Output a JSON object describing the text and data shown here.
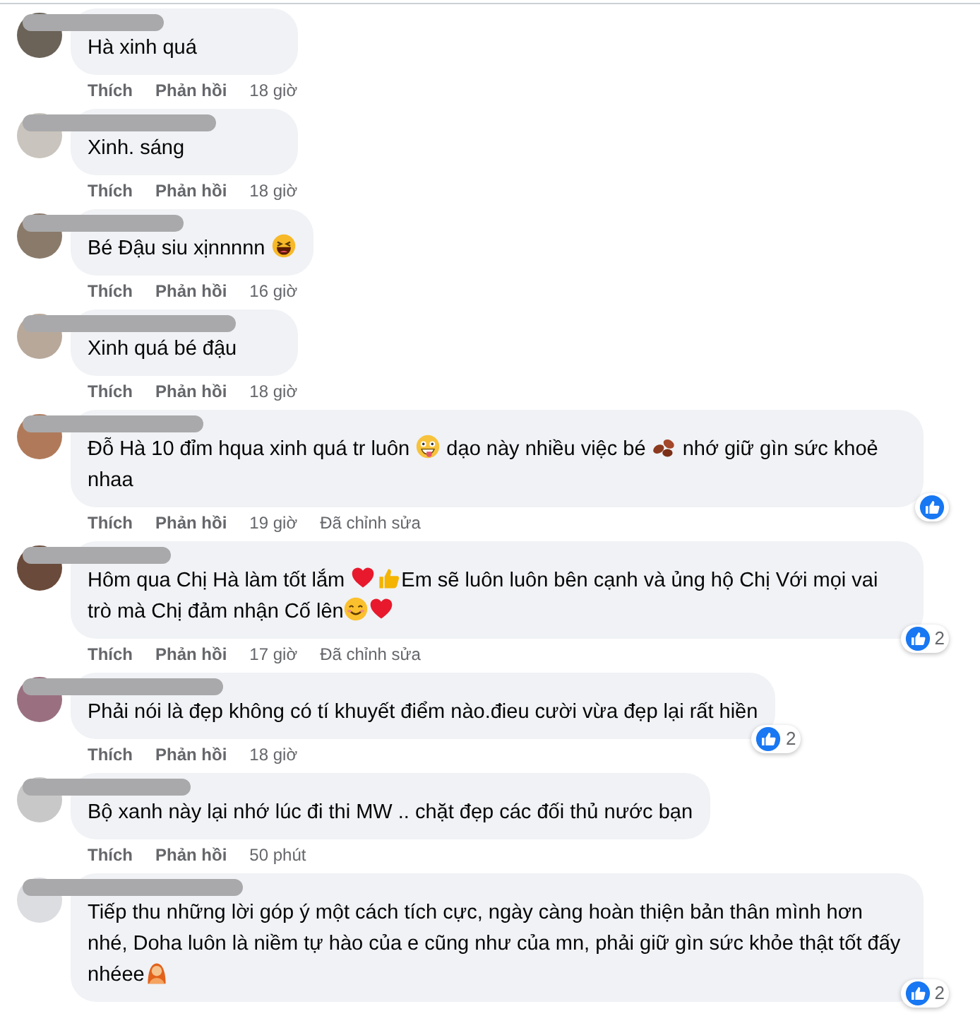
{
  "comments": [
    {
      "parts": [
        {
          "kind": "text",
          "text": "Hà xinh quá"
        }
      ],
      "actions": [
        "Thích",
        "Phản hồi"
      ],
      "time": "18 giờ"
    },
    {
      "parts": [
        {
          "kind": "text",
          "text": "Xinh. sáng"
        }
      ],
      "actions": [
        "Thích",
        "Phản hồi"
      ],
      "time": "18 giờ"
    },
    {
      "parts": [
        {
          "kind": "text",
          "text": "Bé Đậu siu xịnnnnn "
        },
        {
          "kind": "laughing"
        }
      ],
      "actions": [
        "Thích",
        "Phản hồi"
      ],
      "time": "16 giờ"
    },
    {
      "parts": [
        {
          "kind": "text",
          "text": "Xinh quá bé đậu"
        }
      ],
      "actions": [
        "Thích",
        "Phản hồi"
      ],
      "time": "18 giờ"
    },
    {
      "parts": [
        {
          "kind": "text",
          "text": "Đỗ Hà 10 đỉm hqua xinh quá tr luôn "
        },
        {
          "kind": "zany"
        },
        {
          "kind": "text",
          "text": " dạo này nhiều việc bé "
        },
        {
          "kind": "beans"
        },
        {
          "kind": "text",
          "text": " nhớ giữ gìn sức khoẻ nhaa"
        }
      ],
      "actions": [
        "Thích",
        "Phản hồi"
      ],
      "time": "19 giờ",
      "edited": "Đã chỉnh sửa",
      "reactions": {
        "kind": "like"
      }
    },
    {
      "parts": [
        {
          "kind": "text",
          "text": "Hôm qua Chị Hà làm tốt lắm "
        },
        {
          "kind": "heart"
        },
        {
          "kind": "thumbs"
        },
        {
          "kind": "text",
          "text": "Em sẽ luôn luôn bên cạnh và ủng hộ Chị Với mọi vai trò mà Chị đảm nhận Cố lên"
        },
        {
          "kind": "smile"
        },
        {
          "kind": "heart"
        }
      ],
      "actions": [
        "Thích",
        "Phản hồi"
      ],
      "time": "17 giờ",
      "edited": "Đã chỉnh sửa",
      "reactions": {
        "kind": "like",
        "count": "2"
      }
    },
    {
      "parts": [
        {
          "kind": "text",
          "text": "Phải nói là đẹp không có tí khuyết điểm nào.đieu cười vừa đẹp lại rất hiền"
        }
      ],
      "actions": [
        "Thích",
        "Phản hồi"
      ],
      "time": "18 giờ",
      "reactions": {
        "kind": "like",
        "count": "2"
      }
    },
    {
      "parts": [
        {
          "kind": "text",
          "text": "Bộ xanh này lại nhớ lúc đi thi MW .. chặt đẹp các đối thủ nước bạn"
        }
      ],
      "actions": [
        "Thích",
        "Phản hồi"
      ],
      "time": "50 phút"
    },
    {
      "parts": [
        {
          "kind": "text",
          "text": "Tiếp thu những lời góp ý một cách tích cực, ngày càng hoàn thiện bản thân mình hơn nhé, Doha luôn là niềm tự hào của e cũng như của mn, phải giữ gìn sức khỏe thật tốt đấy nhéee"
        },
        {
          "kind": "person"
        }
      ],
      "reactions": {
        "kind": "like",
        "count": "2"
      }
    }
  ]
}
